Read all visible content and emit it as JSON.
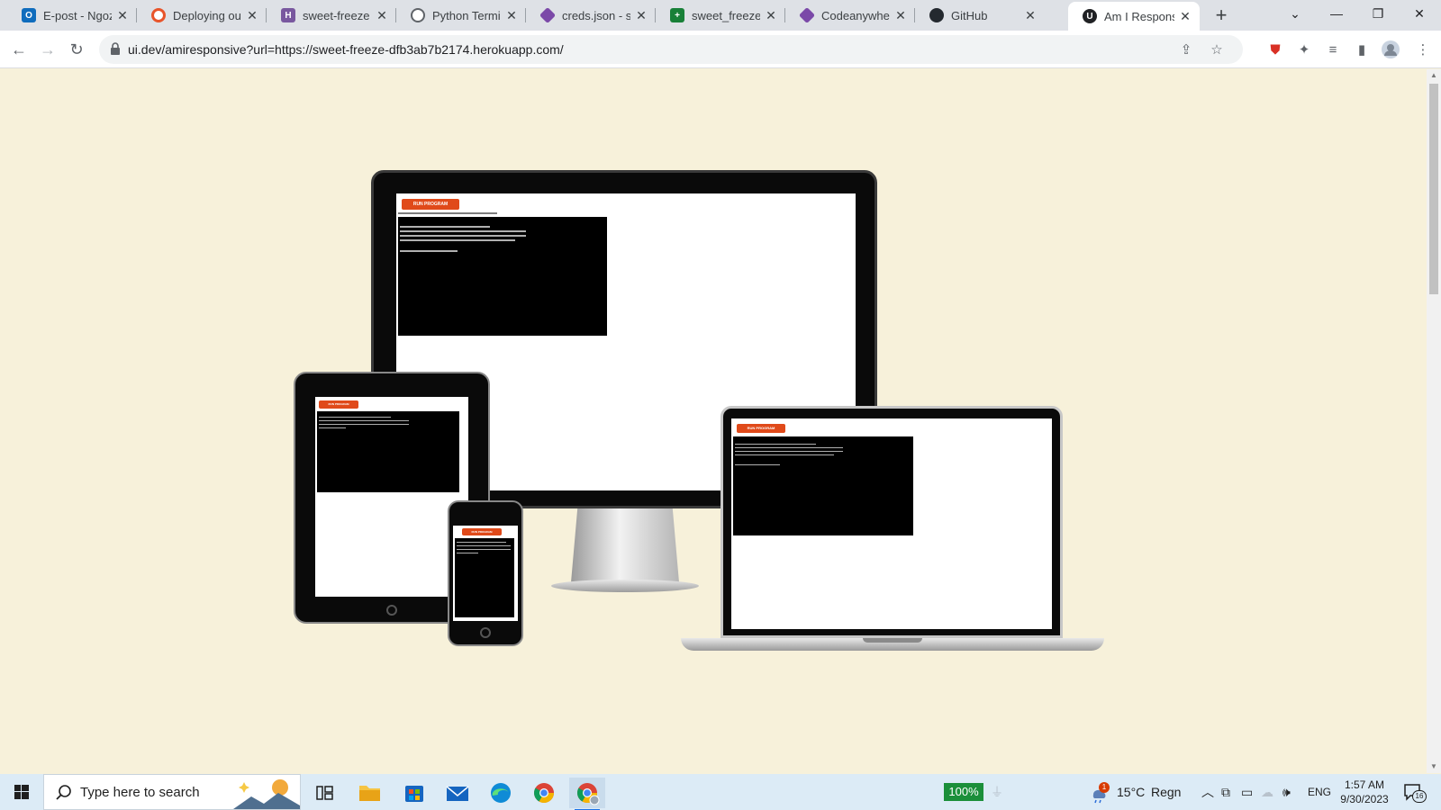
{
  "browser": {
    "tabs": [
      {
        "title": "E-post - Ngozi",
        "favicon": "outlook-icon",
        "color": "#0f6cbd"
      },
      {
        "title": "Deploying our",
        "favicon": "code-institute-icon",
        "color": "#e8542a"
      },
      {
        "title": "sweet-freeze -",
        "favicon": "heroku-icon",
        "color": "#79589f"
      },
      {
        "title": "Python Termin",
        "favicon": "globe-icon",
        "color": "#5f6368"
      },
      {
        "title": "creds.json - sw",
        "favicon": "gitpod-icon",
        "color": "#7b49a8"
      },
      {
        "title": "sweet_freeze -",
        "favicon": "sheets-icon",
        "color": "#188038"
      },
      {
        "title": "Codeanywhere",
        "favicon": "codeanywhere-icon",
        "color": "#7b49a8"
      },
      {
        "title": "GitHub",
        "favicon": "github-icon",
        "color": "#24292f"
      },
      {
        "title": "Am I Responsi",
        "favicon": "amiresponsive-icon",
        "color": "#202124"
      }
    ],
    "active_tab_index": 8,
    "new_tab_label": "+",
    "url": "ui.dev/amiresponsive?url=https://sweet-freeze-dfb3ab7b2174.herokuapp.com/"
  },
  "page": {
    "background": "#f7f1da",
    "run_button_label": "RUN PROGRAM",
    "terminal_header": "Running startup command: python3 run.py",
    "terminal_lines": [
      "Welcome to Sweet Freeze Data Automation",
      "Kindly provide sales data from yesterday's sales.",
      "Data should be twelve numbers, separated by commas.",
      "Example: 10,20,30,40,50,60,70,80,90,10,20,30",
      "",
      "Enter your data here:"
    ]
  },
  "taskbar": {
    "search_placeholder": "Type here to search",
    "battery_percent": "100%",
    "weather_temp": "15°C",
    "weather_text": "Regn",
    "weather_badge": "1",
    "language": "ENG",
    "time": "1:57 AM",
    "date": "9/30/2023",
    "notification_count": "16"
  }
}
